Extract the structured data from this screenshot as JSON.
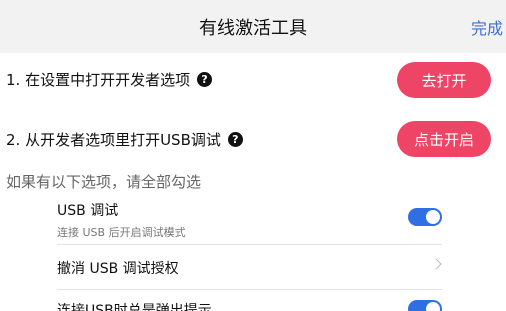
{
  "header": {
    "title": "有线激活工具",
    "done_label": "完成"
  },
  "steps": [
    {
      "text": "1. 在设置中打开开发者选项",
      "button": "去打开"
    },
    {
      "text": "2. 从开发者选项里打开USB调试",
      "button": "点击开启"
    }
  ],
  "hint": "如果有以下选项，请全部勾选",
  "options": [
    {
      "title": "USB 调试",
      "subtitle": "连接 USB 后开启调试模式",
      "control": "toggle",
      "on": true
    },
    {
      "title": "撤消 USB 调试授权",
      "control": "chevron"
    },
    {
      "title": "连接USB时总是弹出提示",
      "control": "toggle",
      "on": true
    }
  ],
  "colors": {
    "accent_pill": "#ee4566",
    "toggle_on": "#2f6fe4",
    "link": "#3d6fd6"
  }
}
